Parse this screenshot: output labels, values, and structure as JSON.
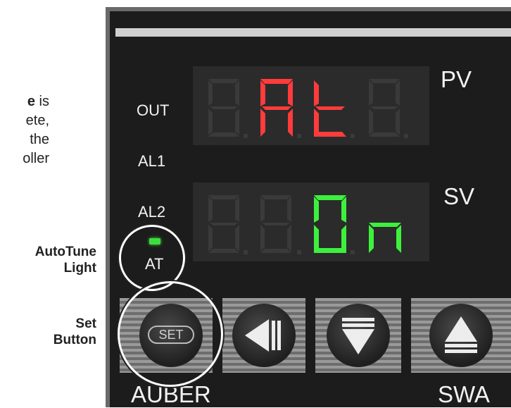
{
  "side_text": {
    "line1_prefix": "",
    "line1_bold": "e",
    "line1_rest": " is",
    "line2": "ete,",
    "line3": "the",
    "line4": "oller"
  },
  "callouts": {
    "autotune_line1": "AutoTune",
    "autotune_line2": "Light",
    "set_line1": "Set",
    "set_line2": "Button"
  },
  "panel": {
    "labels": {
      "out": "OUT",
      "al1": "AL1",
      "al2": "AL2",
      "at": "AT",
      "pv": "PV",
      "sv": "SV",
      "brand": "AUBER",
      "model": "SWA"
    },
    "pv_display": {
      "text": "At",
      "color": "#ff3b3b"
    },
    "sv_display": {
      "text": "On",
      "color": "#3df03d"
    },
    "buttons": [
      {
        "name": "set",
        "label": "SET"
      },
      {
        "name": "shift-left"
      },
      {
        "name": "down"
      },
      {
        "name": "up"
      }
    ],
    "colors": {
      "panel_bg": "#1c1c1c",
      "display_bg": "#2b2b2b",
      "dim_segment": "#3a3a3a",
      "led": "#3fdc3f"
    }
  }
}
